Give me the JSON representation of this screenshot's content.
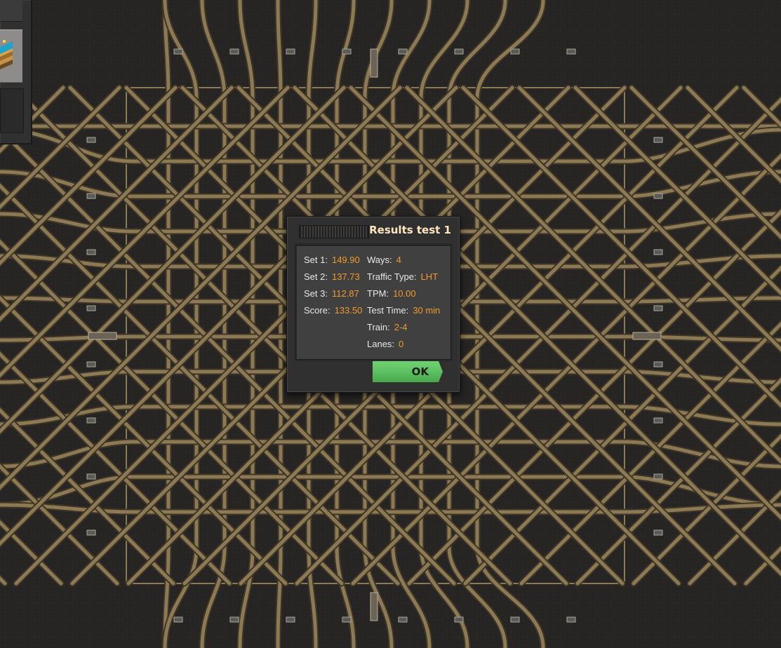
{
  "dialog": {
    "title": "Results test 1",
    "ok_label": "OK",
    "stats_left": [
      {
        "label": "Set 1:",
        "value": "149.90"
      },
      {
        "label": "Set 2:",
        "value": "137.73"
      },
      {
        "label": "Set 3:",
        "value": "112.87"
      },
      {
        "label": "Score:",
        "value": "133.50"
      }
    ],
    "stats_right": [
      {
        "label": "Ways:",
        "value": "4"
      },
      {
        "label": "Traffic Type:",
        "value": "LHT"
      },
      {
        "label": "TPM:",
        "value": "10.00"
      },
      {
        "label": "Test Time:",
        "value": "30 min"
      },
      {
        "label": "Train:",
        "value": "2-4"
      },
      {
        "label": "Lanes:",
        "value": "0"
      }
    ]
  },
  "colors": {
    "ground": "#262524",
    "rail": "#8c7a55",
    "value_text": "#f09a2a",
    "title_text": "#ffe6c0",
    "ok_button": "#5fc264"
  },
  "world": {
    "track_lines": 12,
    "icons": [
      "rail-track",
      "rail-signal-icon",
      "train-stop-icon",
      "blueprint-book-icon"
    ]
  }
}
